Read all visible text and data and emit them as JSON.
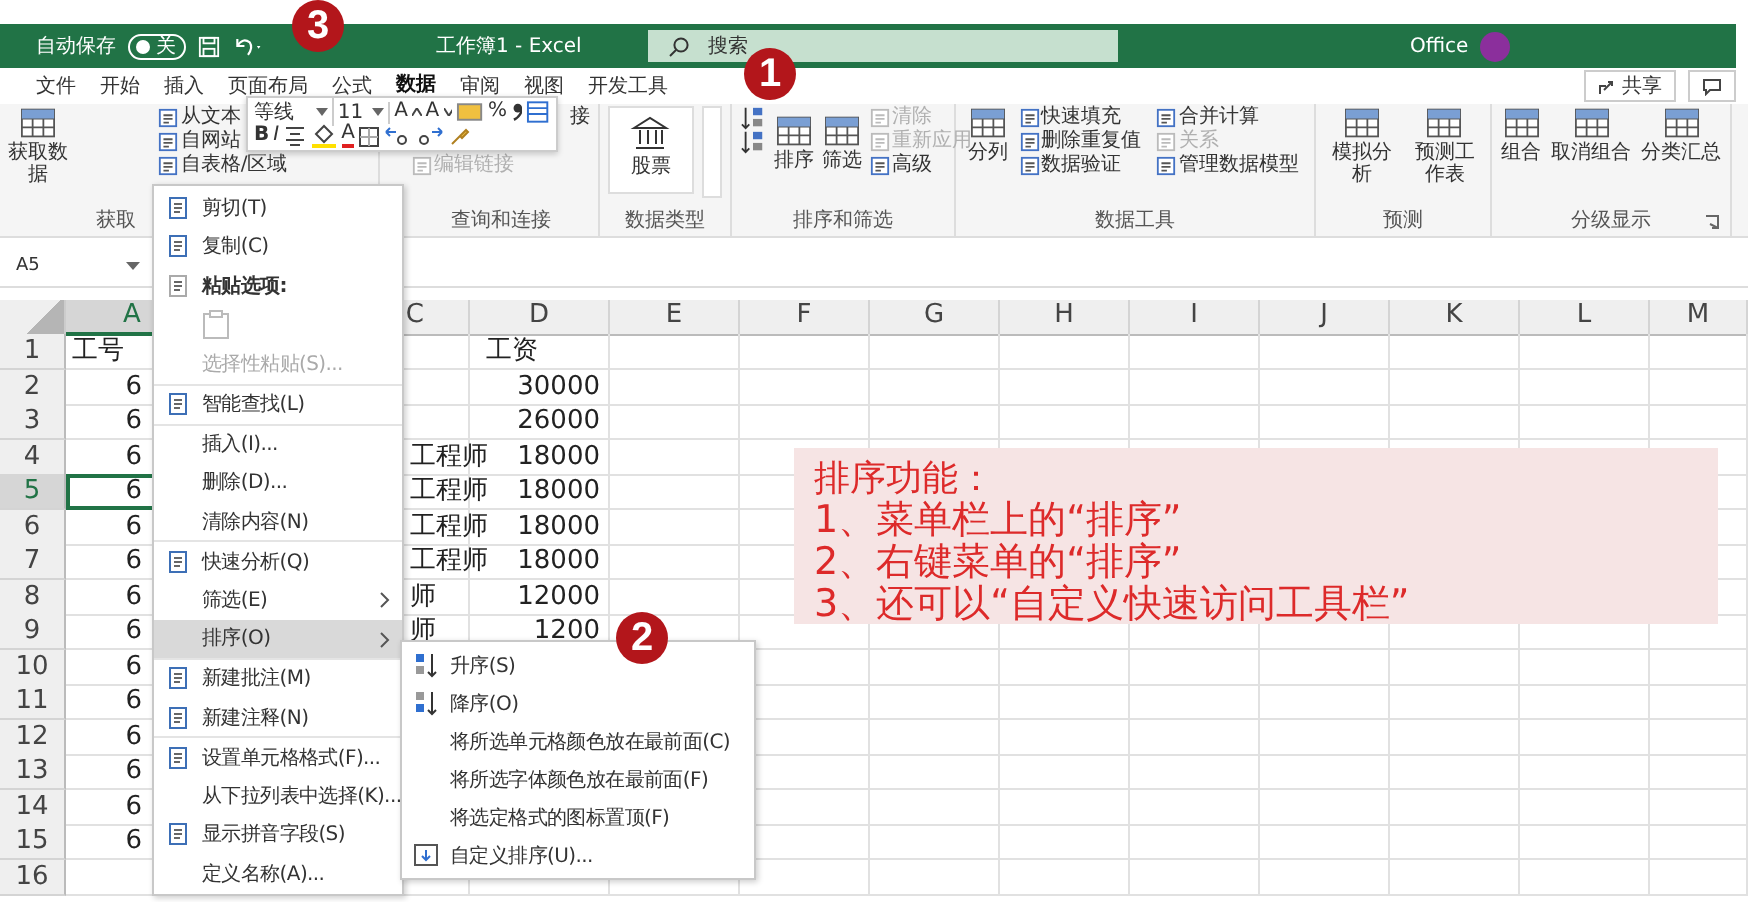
{
  "title_bar": {
    "autosave_label": "自动保存",
    "autosave_toggle": "关",
    "autosave_on": false,
    "title": "工作簿1 - Excel",
    "search_placeholder": "搜索",
    "account": "Office"
  },
  "tabs": [
    {
      "label": "文件",
      "selected": false
    },
    {
      "label": "开始",
      "selected": false
    },
    {
      "label": "插入",
      "selected": false
    },
    {
      "label": "页面布局",
      "selected": false
    },
    {
      "label": "公式",
      "selected": false
    },
    {
      "label": "数据",
      "selected": true
    },
    {
      "label": "审阅",
      "selected": false
    },
    {
      "label": "视图",
      "selected": false
    },
    {
      "label": "开发工具",
      "selected": false
    }
  ],
  "share_button": "共享",
  "ribbon_groups": [
    {
      "label": "获取",
      "items": [
        {
          "kind": "large",
          "label": "获取数据",
          "disabled": false
        },
        {
          "kind": "small",
          "label": "从文本",
          "disabled": false
        },
        {
          "kind": "small",
          "label": "自网站",
          "disabled": false
        },
        {
          "kind": "small",
          "label": "自表格/区域",
          "disabled": false
        }
      ]
    },
    {
      "label": "查询和连接",
      "items": [
        {
          "kind": "text",
          "label": "接",
          "disabled": false
        },
        {
          "kind": "small",
          "label": "编辑链接",
          "disabled": true
        }
      ]
    },
    {
      "label": "数据类型",
      "items": [
        {
          "kind": "gallery",
          "label": "股票",
          "disabled": false
        }
      ]
    },
    {
      "label": "排序和筛选",
      "items": [
        {
          "kind": "icon",
          "disabled": false
        },
        {
          "kind": "icon",
          "disabled": false
        },
        {
          "kind": "large",
          "label": "排序",
          "disabled": false
        },
        {
          "kind": "large",
          "label": "筛选",
          "disabled": false
        },
        {
          "kind": "small",
          "label": "清除",
          "disabled": true
        },
        {
          "kind": "small",
          "label": "重新应用",
          "disabled": true
        },
        {
          "kind": "small",
          "label": "高级",
          "disabled": false
        }
      ]
    },
    {
      "label": "数据工具",
      "items": [
        {
          "kind": "large",
          "label": "分列",
          "disabled": false
        },
        {
          "kind": "small",
          "label": "快速填充",
          "disabled": false
        },
        {
          "kind": "small",
          "label": "删除重复值",
          "disabled": false
        },
        {
          "kind": "small",
          "label": "数据验证",
          "disabled": false
        },
        {
          "kind": "small",
          "label": "合并计算",
          "disabled": false
        },
        {
          "kind": "small",
          "label": "关系",
          "disabled": true
        },
        {
          "kind": "small",
          "label": "管理数据模型",
          "disabled": false
        }
      ]
    },
    {
      "label": "预测",
      "items": [
        {
          "kind": "large",
          "label": "模拟分析",
          "disabled": false
        },
        {
          "kind": "large",
          "label": "预测工作表",
          "disabled": false
        }
      ]
    },
    {
      "label": "分级显示",
      "items": [
        {
          "kind": "large",
          "label": "组合",
          "disabled": false
        },
        {
          "kind": "large",
          "label": "取消组合",
          "disabled": false
        },
        {
          "kind": "large",
          "label": "分类汇总",
          "disabled": false
        }
      ]
    }
  ],
  "mini_toolbar": {
    "font": "等线",
    "size": "11",
    "grow": "A",
    "shrink": "A",
    "percent": "%",
    "bold": "B",
    "italic": "I",
    "font_color": "A"
  },
  "name_box": "A5",
  "columns": [
    {
      "label": "A",
      "selected": true
    },
    {
      "label": "C",
      "selected": false
    },
    {
      "label": "D",
      "selected": false
    },
    {
      "label": "E",
      "selected": false
    },
    {
      "label": "F",
      "selected": false
    },
    {
      "label": "G",
      "selected": false
    },
    {
      "label": "H",
      "selected": false
    },
    {
      "label": "I",
      "selected": false
    },
    {
      "label": "J",
      "selected": false
    },
    {
      "label": "K",
      "selected": false
    },
    {
      "label": "L",
      "selected": false
    },
    {
      "label": "M",
      "selected": false
    }
  ],
  "rows": [
    {
      "number": "1",
      "kind": "header",
      "a": "工号",
      "d": "工资",
      "selected": false
    },
    {
      "number": "2",
      "kind": "data",
      "a": "6",
      "d": "30000",
      "selected": false
    },
    {
      "number": "3",
      "kind": "data",
      "a": "6",
      "d": "26000",
      "selected": false
    },
    {
      "number": "4",
      "kind": "data",
      "a": "6",
      "c": "工程师",
      "d": "18000",
      "selected": false
    },
    {
      "number": "5",
      "kind": "data",
      "a": "6",
      "c": "工程师",
      "d": "18000",
      "selected": true
    },
    {
      "number": "6",
      "kind": "data",
      "a": "6",
      "c": "工程师",
      "d": "18000",
      "selected": false
    },
    {
      "number": "7",
      "kind": "data",
      "a": "6",
      "c": "工程师",
      "d": "18000",
      "selected": false
    },
    {
      "number": "8",
      "kind": "data",
      "a": "6",
      "c": "师",
      "d": "12000",
      "selected": false
    },
    {
      "number": "9",
      "kind": "data",
      "a": "6",
      "c": "师",
      "d": "1200",
      "selected": false
    },
    {
      "number": "10",
      "kind": "data",
      "a": "6",
      "selected": false
    },
    {
      "number": "11",
      "kind": "data",
      "a": "6",
      "selected": false
    },
    {
      "number": "12",
      "kind": "data",
      "a": "6",
      "selected": false
    },
    {
      "number": "13",
      "kind": "data",
      "a": "6",
      "selected": false
    },
    {
      "number": "14",
      "kind": "data",
      "a": "6",
      "selected": false
    },
    {
      "number": "15",
      "kind": "data",
      "a": "6",
      "selected": false
    },
    {
      "number": "16",
      "kind": "data",
      "selected": false
    }
  ],
  "context_menu": [
    {
      "kind": "command",
      "label": "剪切(T)",
      "disabled": false,
      "submenu": false,
      "selected": false,
      "separator_before": false
    },
    {
      "kind": "command",
      "label": "复制(C)",
      "disabled": false,
      "submenu": false,
      "selected": false,
      "separator_before": false
    },
    {
      "kind": "heading",
      "label": "粘贴选项:",
      "disabled": false,
      "submenu": false,
      "selected": false,
      "separator_before": false
    },
    {
      "kind": "paste",
      "disabled": true,
      "submenu": false,
      "selected": false,
      "separator_before": false
    },
    {
      "kind": "plain",
      "label": "选择性粘贴(S)...",
      "disabled": true,
      "submenu": false,
      "selected": false,
      "separator_before": false
    },
    {
      "kind": "command",
      "label": "智能查找(L)",
      "disabled": false,
      "submenu": false,
      "selected": false,
      "separator_before": true
    },
    {
      "kind": "plain",
      "label": "插入(I)...",
      "disabled": false,
      "submenu": false,
      "selected": false,
      "separator_before": true
    },
    {
      "kind": "plain",
      "label": "删除(D)...",
      "disabled": false,
      "submenu": false,
      "selected": false,
      "separator_before": false
    },
    {
      "kind": "plain",
      "label": "清除内容(N)",
      "disabled": false,
      "submenu": false,
      "selected": false,
      "separator_before": false
    },
    {
      "kind": "command",
      "label": "快速分析(Q)",
      "disabled": false,
      "submenu": false,
      "selected": false,
      "separator_before": true
    },
    {
      "kind": "plain",
      "label": "筛选(E)",
      "disabled": false,
      "submenu": true,
      "selected": false,
      "separator_before": false
    },
    {
      "kind": "plain",
      "label": "排序(O)",
      "disabled": false,
      "submenu": true,
      "selected": true,
      "separator_before": false
    },
    {
      "kind": "command",
      "label": "新建批注(M)",
      "disabled": false,
      "submenu": false,
      "selected": false,
      "separator_before": true
    },
    {
      "kind": "command",
      "label": "新建注释(N)",
      "disabled": false,
      "submenu": false,
      "selected": false,
      "separator_before": false
    },
    {
      "kind": "command",
      "label": "设置单元格格式(F)...",
      "disabled": false,
      "submenu": false,
      "selected": false,
      "separator_before": true
    },
    {
      "kind": "plain",
      "label": "从下拉列表中选择(K)...",
      "disabled": false,
      "submenu": false,
      "selected": false,
      "separator_before": false
    },
    {
      "kind": "command",
      "label": "显示拼音字段(S)",
      "disabled": false,
      "submenu": false,
      "selected": false,
      "separator_before": false
    },
    {
      "kind": "plain",
      "label": "定义名称(A)...",
      "disabled": false,
      "submenu": false,
      "selected": false,
      "separator_before": false
    }
  ],
  "sort_submenu": [
    {
      "kind": "ascending",
      "label": "升序(S)",
      "selected": false
    },
    {
      "kind": "descending",
      "label": "降序(O)",
      "selected": false
    },
    {
      "kind": "plain",
      "label": "将所选单元格颜色放在最前面(C)",
      "selected": false
    },
    {
      "kind": "plain",
      "label": "将所选字体颜色放在最前面(F)",
      "selected": false
    },
    {
      "kind": "plain",
      "label": "将选定格式的图标置顶(F)",
      "selected": false
    },
    {
      "kind": "custom",
      "label": "自定义排序(U)...",
      "selected": false
    }
  ],
  "annotation": {
    "title": "排序功能：",
    "lines": [
      "1、菜单栏上的“排序”",
      "2、右键菜单的“排序”",
      "3、还可以“自定义快速访问工具栏”"
    ]
  },
  "callouts": [
    "3",
    "1",
    "2"
  ]
}
